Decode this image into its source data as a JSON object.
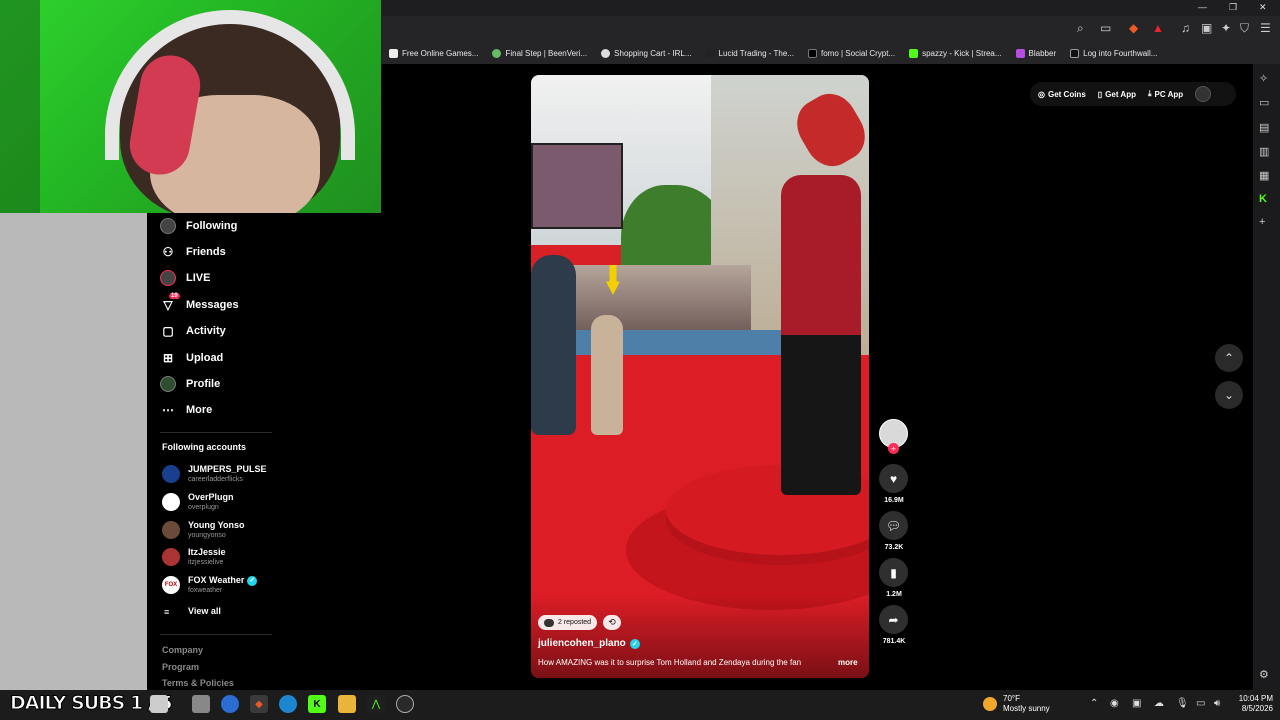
{
  "bookmarks": [
    {
      "label": "Free Online Games..."
    },
    {
      "label": "Final Step | BeenVeri..."
    },
    {
      "label": "Shopping Cart - IRL..."
    },
    {
      "label": "Lucid Trading - The..."
    },
    {
      "label": "fomo | Social Crypt..."
    },
    {
      "label": "spazzy - Kick | Strea..."
    },
    {
      "label": "Blabber"
    },
    {
      "label": "Log into Fourthwall..."
    }
  ],
  "nav": {
    "items": [
      {
        "label": "Following",
        "icon": "following-avatar-icon"
      },
      {
        "label": "Friends",
        "icon": "friends-icon"
      },
      {
        "label": "LIVE",
        "icon": "live-icon"
      },
      {
        "label": "Messages",
        "icon": "messages-icon",
        "badge": "19"
      },
      {
        "label": "Activity",
        "icon": "activity-icon"
      },
      {
        "label": "Upload",
        "icon": "upload-icon"
      },
      {
        "label": "Profile",
        "icon": "profile-icon"
      },
      {
        "label": "More",
        "icon": "more-icon"
      }
    ],
    "following_title": "Following accounts",
    "accounts": [
      {
        "name": "JUMPERS_PULSE",
        "handle": "careerladderflicks"
      },
      {
        "name": "OverPlugn",
        "handle": "overplugn"
      },
      {
        "name": "Young Yonso",
        "handle": "youngyonso"
      },
      {
        "name": "ItzJessie",
        "handle": "itzjessielive"
      },
      {
        "name": "FOX Weather",
        "handle": "foxweather"
      }
    ],
    "view_all": "View all",
    "footer": [
      "Company",
      "Program",
      "Terms & Policies"
    ]
  },
  "top_actions": {
    "get_coins": "Get Coins",
    "get_app": "Get App",
    "pc_app": "PC App"
  },
  "video": {
    "reposted": "2 reposted",
    "author": "juliencohen_plano",
    "caption": "How AMAZING was it to surprise Tom Holland and Zendaya during the fan",
    "more": "more"
  },
  "actions": {
    "likes": "16.9M",
    "comments": "73.2K",
    "saves": "1.2M",
    "shares": "781.4K"
  },
  "taskbar": {
    "overlay_text": "DAILY SUBS 1 / 5",
    "temp": "70°F",
    "weather": "Mostly sunny",
    "time": "10:04 PM",
    "date": "8/5/2026"
  },
  "colors": {
    "tiktok_red": "#fe2c55",
    "verified": "#20d5ec",
    "webcam_green": "#2fd42f"
  }
}
